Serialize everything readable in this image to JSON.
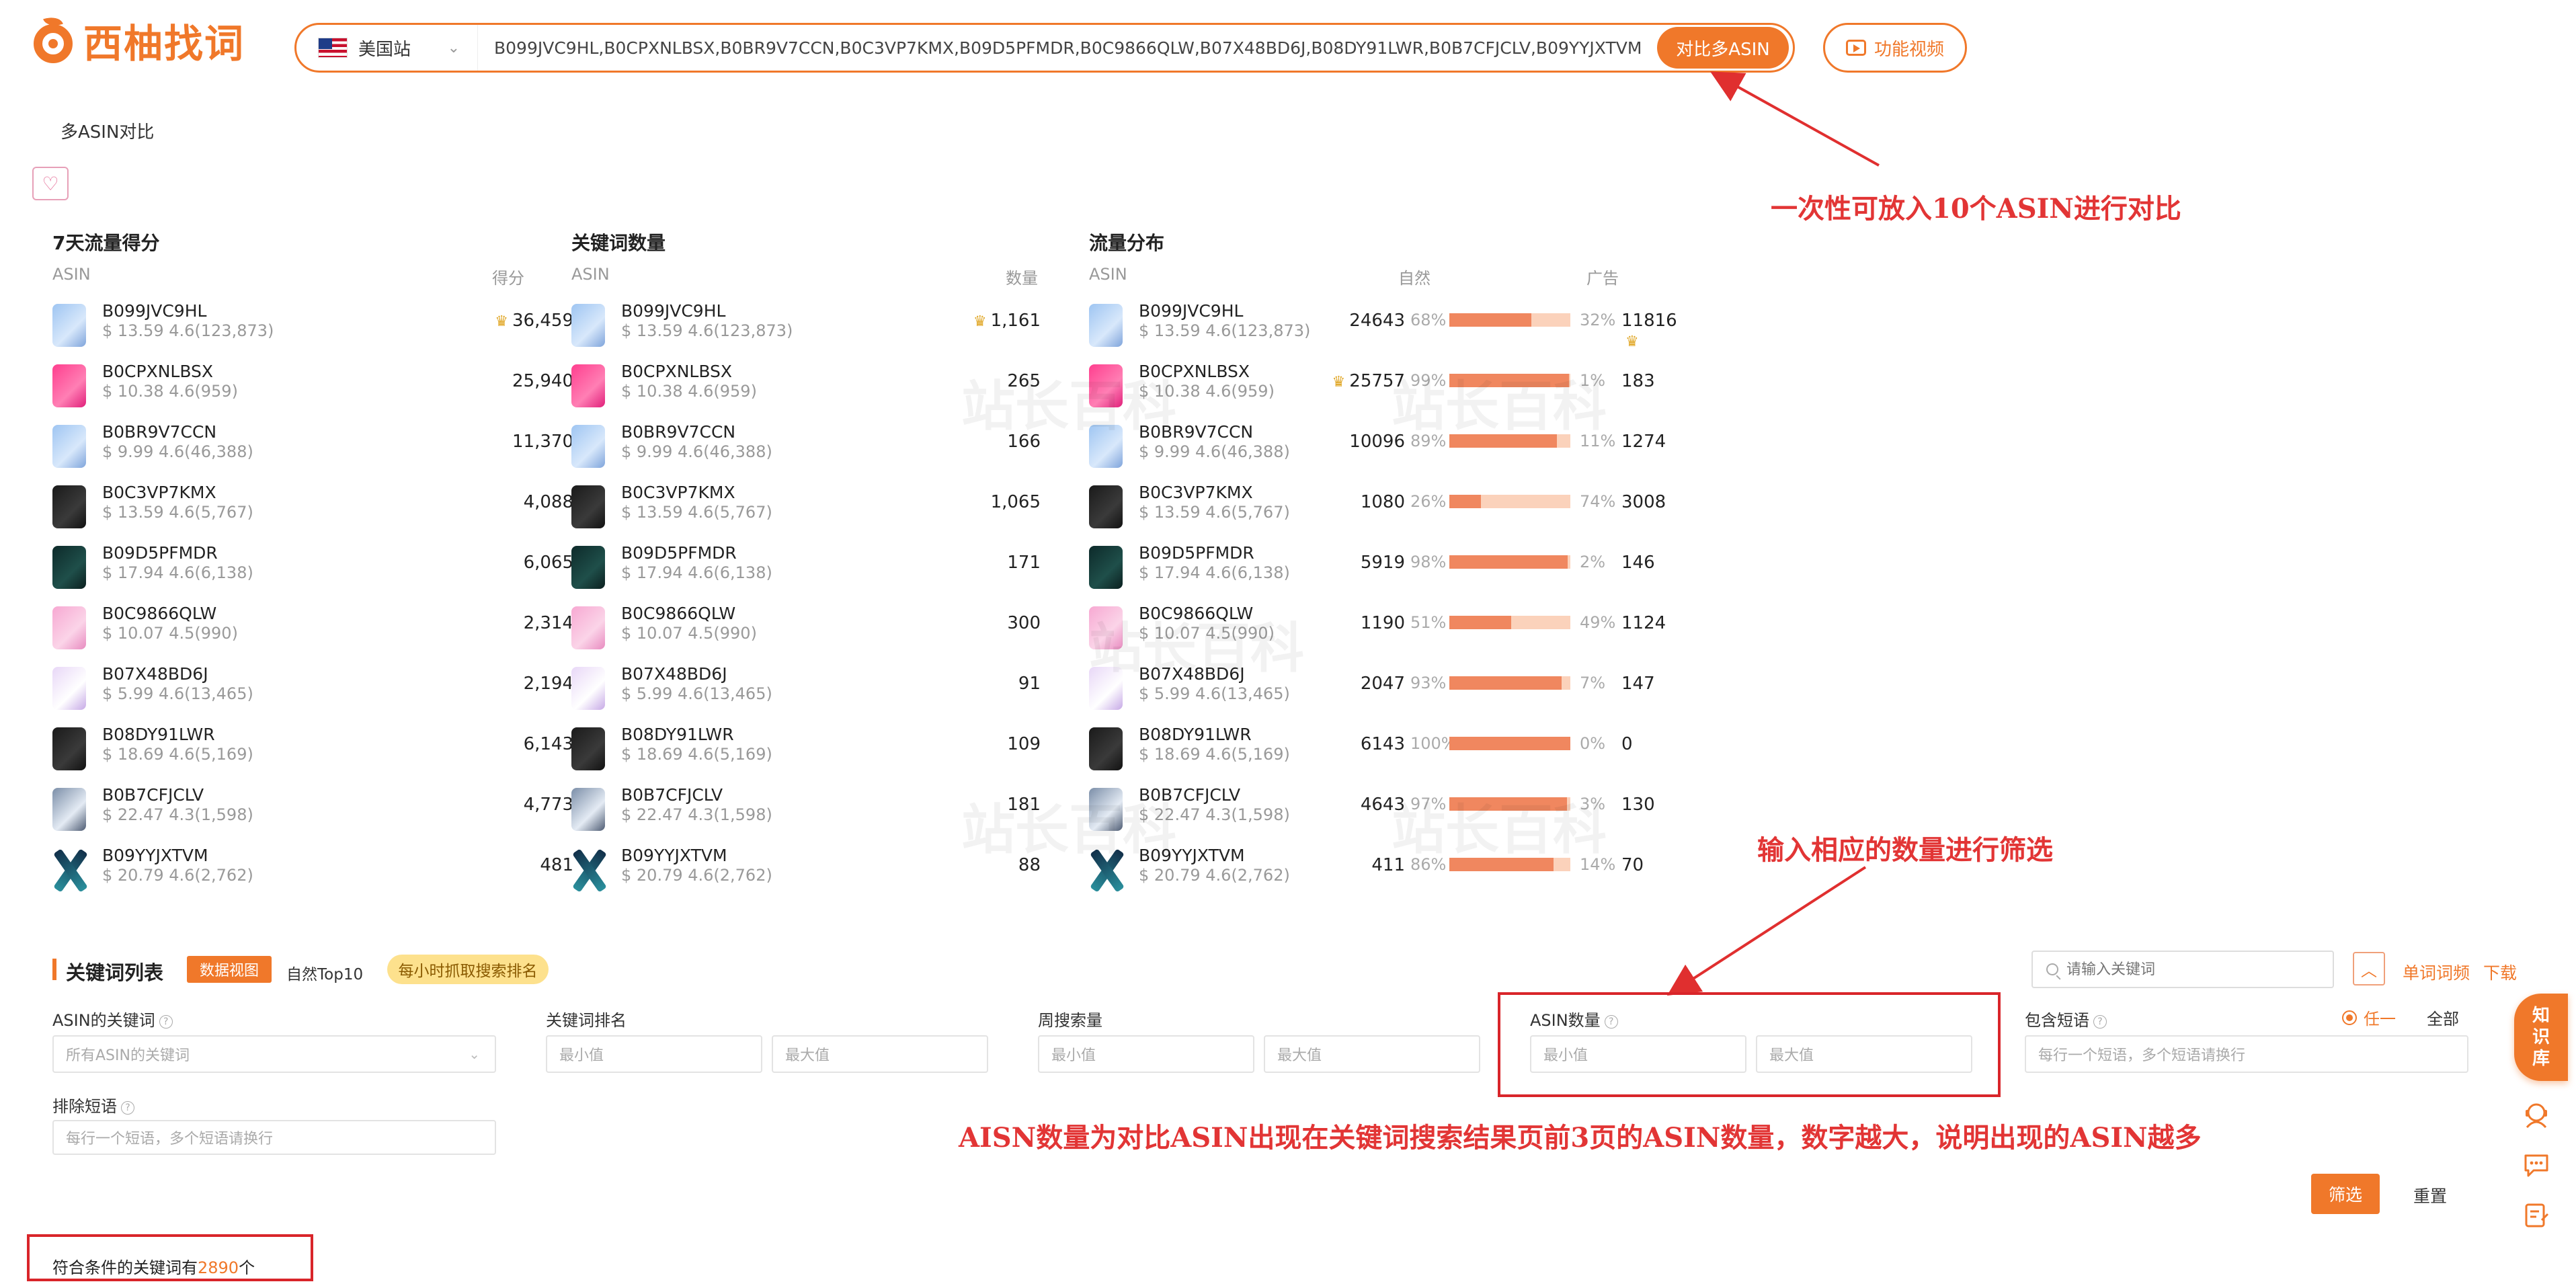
{
  "brand": {
    "name": "西柚找词"
  },
  "search": {
    "site": "美国站",
    "value": "B099JVC9HL,B0CPXNLBSX,B0BR9V7CCN,B0C3VP7KMX,B09D5PFMDR,B0C9866QLW,B07X48BD6J,B08DY91LWR,B0B7CFJCLV,B09YYJXTVM",
    "compare_label": "对比多ASIN"
  },
  "video_btn": "功能视频",
  "breadcrumb": "多ASIN对比",
  "panels": {
    "traffic": {
      "title": "7天流量得分",
      "col_asin": "ASIN",
      "col_value": "得分"
    },
    "keywords": {
      "title": "关键词数量",
      "col_asin": "ASIN",
      "col_value": "数量"
    },
    "flow": {
      "title": "流量分布",
      "col_asin": "ASIN",
      "col_natural": "自然",
      "col_ad": "广告"
    }
  },
  "products": [
    {
      "asin": "B099JVC9HL",
      "meta": "$ 13.59  4.6(123,873)",
      "score": "36,459",
      "kw": "1,161",
      "nat": "24643",
      "nat_pct": "68%",
      "nat_frac": 0.68,
      "ad_pct": "32%",
      "ad": "11816",
      "thumb": "phone-blue"
    },
    {
      "asin": "B0CPXNLBSX",
      "meta": "$ 10.38  4.6(959)",
      "score": "25,940",
      "kw": "265",
      "nat": "25757",
      "nat_pct": "99%",
      "nat_frac": 0.99,
      "ad_pct": "1%",
      "ad": "183",
      "thumb": "phone-pink"
    },
    {
      "asin": "B0BR9V7CCN",
      "meta": "$ 9.99  4.6(46,388)",
      "score": "11,370",
      "kw": "166",
      "nat": "10096",
      "nat_pct": "89%",
      "nat_frac": 0.89,
      "ad_pct": "11%",
      "ad": "1274",
      "thumb": "phone-blue"
    },
    {
      "asin": "B0C3VP7KMX",
      "meta": "$ 13.59  4.6(5,767)",
      "score": "4,088",
      "kw": "1,065",
      "nat": "1080",
      "nat_pct": "26%",
      "nat_frac": 0.26,
      "ad_pct": "74%",
      "ad": "3008",
      "thumb": "phone-black"
    },
    {
      "asin": "B09D5PFMDR",
      "meta": "$ 17.94  4.6(6,138)",
      "score": "6,065",
      "kw": "171",
      "nat": "5919",
      "nat_pct": "98%",
      "nat_frac": 0.98,
      "ad_pct": "2%",
      "ad": "146",
      "thumb": "phone-green"
    },
    {
      "asin": "B0C9866QLW",
      "meta": "$ 10.07  4.5(990)",
      "score": "2,314",
      "kw": "300",
      "nat": "1190",
      "nat_pct": "51%",
      "nat_frac": 0.51,
      "ad_pct": "49%",
      "ad": "1124",
      "thumb": "phone-lpink"
    },
    {
      "asin": "B07X48BD6J",
      "meta": "$ 5.99  4.6(13,465)",
      "score": "2,194",
      "kw": "91",
      "nat": "2047",
      "nat_pct": "93%",
      "nat_frac": 0.93,
      "ad_pct": "7%",
      "ad": "147",
      "thumb": "phone-lilac"
    },
    {
      "asin": "B08DY91LWR",
      "meta": "$ 18.69  4.6(5,169)",
      "score": "6,143",
      "kw": "109",
      "nat": "6143",
      "nat_pct": "100%",
      "nat_frac": 1.0,
      "ad_pct": "0%",
      "ad": "0",
      "thumb": "phone-black"
    },
    {
      "asin": "B0B7CFJCLV",
      "meta": "$ 22.47  4.3(1,598)",
      "score": "4,773",
      "kw": "181",
      "nat": "4643",
      "nat_pct": "97%",
      "nat_frac": 0.97,
      "ad_pct": "3%",
      "ad": "130",
      "thumb": "phone-silver"
    },
    {
      "asin": "B09YYJXTVM",
      "meta": "$ 20.79  4.6(2,762)",
      "score": "481",
      "kw": "88",
      "nat": "411",
      "nat_pct": "86%",
      "nat_frac": 0.86,
      "ad_pct": "14%",
      "ad": "70",
      "thumb": "xmark"
    }
  ],
  "annotations": {
    "top": "一次性可放入10个ASIN进行对比",
    "mid": "输入相应的数量进行筛选",
    "bottom": "AISN数量为对比ASIN出现在关键词搜索结果页前3页的ASIN数量，数字越大，说明出现的ASIN越多"
  },
  "kwlist": {
    "title": "关键词列表",
    "view_btn": "数据视图",
    "top10": "自然Top10",
    "hourly": "每小时抓取搜索排名",
    "search_placeholder": "请输入关键词",
    "single_freq": "单词词频",
    "download": "下载",
    "filters": {
      "asin_kw": {
        "label": "ASIN的关键词",
        "placeholder": "所有ASIN的关键词"
      },
      "rank": {
        "label": "关键词排名",
        "min": "最小值",
        "max": "最大值"
      },
      "weekly": {
        "label": "周搜索量",
        "min": "最小值",
        "max": "最大值"
      },
      "asin_count": {
        "label": "ASIN数量",
        "min": "最小值",
        "max": "最大值"
      },
      "include": {
        "label": "包含短语",
        "placeholder": "每行一个短语，多个短语请换行",
        "opt_any": "任一",
        "opt_all": "全部"
      },
      "exclude": {
        "label": "排除短语",
        "placeholder": "每行一个短语，多个短语请换行"
      }
    },
    "filter_btn": "筛选",
    "reset_btn": "重置",
    "result_prefix": "符合条件的关键词有",
    "result_count": "2890",
    "result_suffix": "个"
  },
  "side": {
    "kb_line1": "知",
    "kb_line2": "识",
    "kb_line3": "库"
  }
}
